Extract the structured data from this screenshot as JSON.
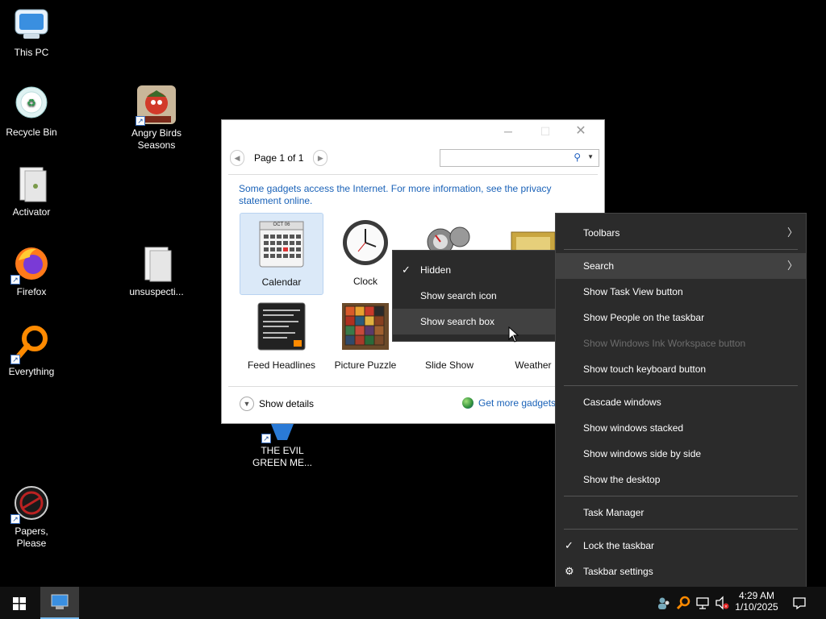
{
  "desktop_icons": [
    {
      "label": "This PC"
    },
    {
      "label": "Recycle Bin"
    },
    {
      "label": "Angry Birds Seasons"
    },
    {
      "label": "Activator"
    },
    {
      "label": "Firefox"
    },
    {
      "label": "unsuspecti..."
    },
    {
      "label": "Everything"
    },
    {
      "label": "THE EVIL GREEN ME..."
    },
    {
      "label": "Papers, Please"
    }
  ],
  "gadgets_window": {
    "page_indicator": "Page 1 of 1",
    "search_placeholder": "",
    "info_text": "Some gadgets access the Internet.  For more information, see the privacy statement online.",
    "tiles": [
      {
        "label": "Calendar"
      },
      {
        "label": "Clock"
      },
      {
        "label": "Feed Headlines"
      },
      {
        "label": "Picture Puzzle"
      },
      {
        "label": "Slide Show"
      },
      {
        "label": "Weather"
      }
    ],
    "calendar_month": "OCT 06",
    "show_details": "Show details",
    "get_more": "Get more gadgets online"
  },
  "search_submenu": {
    "items": [
      {
        "label": "Hidden",
        "checked": true
      },
      {
        "label": "Show search icon",
        "checked": false
      },
      {
        "label": "Show search box",
        "checked": false,
        "hover": true
      }
    ]
  },
  "taskbar_menu": {
    "items": [
      {
        "label": "Toolbars",
        "submenu": true
      },
      {
        "label": "Search",
        "submenu": true,
        "hover": true
      },
      {
        "label": "Show Task View button"
      },
      {
        "label": "Show People on the taskbar"
      },
      {
        "label": "Show Windows Ink Workspace button",
        "disabled": true
      },
      {
        "label": "Show touch keyboard button"
      },
      {
        "label": "Cascade windows"
      },
      {
        "label": "Show windows stacked"
      },
      {
        "label": "Show windows side by side"
      },
      {
        "label": "Show the desktop"
      },
      {
        "label": "Task Manager"
      },
      {
        "label": "Lock the taskbar",
        "checked": true
      },
      {
        "label": "Taskbar settings",
        "icon": "gear-icon"
      }
    ]
  },
  "taskbar": {
    "time": "4:29 AM",
    "date": "1/10/2025"
  },
  "colors": {
    "menu_bg": "#2b2b2b",
    "menu_hover": "#414141",
    "link_blue": "#1a62b8",
    "taskbar_bg": "#101010"
  }
}
